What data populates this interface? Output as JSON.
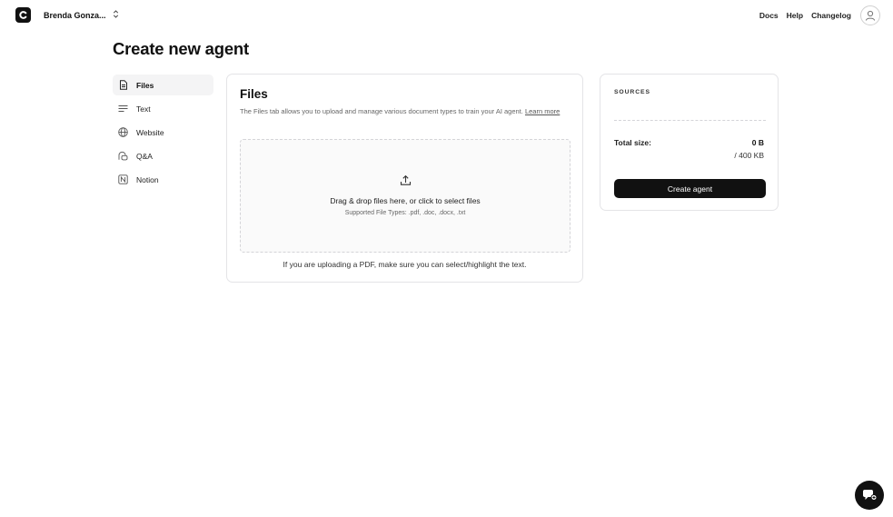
{
  "header": {
    "workspace_name": "Brenda Gonza...",
    "nav": [
      {
        "label": "Docs"
      },
      {
        "label": "Help"
      },
      {
        "label": "Changelog"
      }
    ],
    "icons": {
      "logo": "chatbase-logo-icon",
      "switcher": "chevron-up-down-icon",
      "avatar": "user-avatar-icon"
    }
  },
  "page": {
    "title": "Create new agent"
  },
  "sidebar": {
    "items": [
      {
        "label": "Files",
        "icon": "file-icon",
        "active": true
      },
      {
        "label": "Text",
        "icon": "text-lines-icon",
        "active": false
      },
      {
        "label": "Website",
        "icon": "globe-icon",
        "active": false
      },
      {
        "label": "Q&A",
        "icon": "qa-chat-icon",
        "active": false
      },
      {
        "label": "Notion",
        "icon": "notion-icon",
        "active": false
      }
    ]
  },
  "files_panel": {
    "title": "Files",
    "description": "The Files tab allows you to upload and manage various document types to train your AI agent.",
    "learn_more": "Learn more",
    "dropzone": {
      "icon": "upload-icon",
      "main_text": "Drag & drop files here, or click to select files",
      "supported_types": "Supported File Types: .pdf, .doc, .docx, .txt"
    },
    "pdf_note": "If you are uploading a PDF, make sure you can select/highlight the text."
  },
  "sources_panel": {
    "label": "SOURCES",
    "total_size_label": "Total size:",
    "total_size_value": "0 B",
    "size_limit": "/ 400 KB",
    "create_button": "Create agent"
  },
  "chat_widget": {
    "icon": "chat-bubble-icon"
  },
  "colors": {
    "accent": "#111111",
    "background": "#ffffff",
    "muted_text": "#666666",
    "border": "#e4e4e7"
  }
}
